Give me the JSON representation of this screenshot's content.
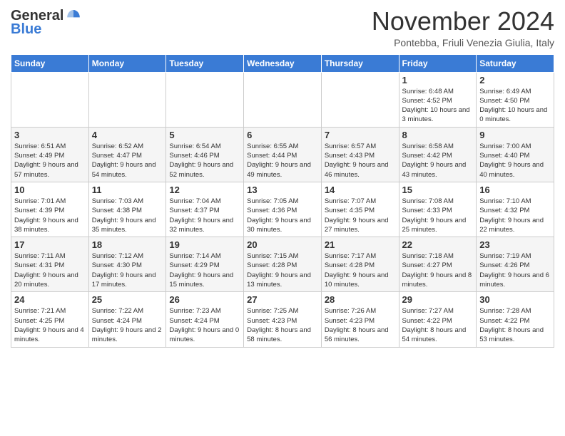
{
  "logo": {
    "general": "General",
    "blue": "Blue"
  },
  "title": "November 2024",
  "location": "Pontebba, Friuli Venezia Giulia, Italy",
  "days_of_week": [
    "Sunday",
    "Monday",
    "Tuesday",
    "Wednesday",
    "Thursday",
    "Friday",
    "Saturday"
  ],
  "weeks": [
    [
      {
        "day": "",
        "content": ""
      },
      {
        "day": "",
        "content": ""
      },
      {
        "day": "",
        "content": ""
      },
      {
        "day": "",
        "content": ""
      },
      {
        "day": "",
        "content": ""
      },
      {
        "day": "1",
        "content": "Sunrise: 6:48 AM\nSunset: 4:52 PM\nDaylight: 10 hours and 3 minutes."
      },
      {
        "day": "2",
        "content": "Sunrise: 6:49 AM\nSunset: 4:50 PM\nDaylight: 10 hours and 0 minutes."
      }
    ],
    [
      {
        "day": "3",
        "content": "Sunrise: 6:51 AM\nSunset: 4:49 PM\nDaylight: 9 hours and 57 minutes."
      },
      {
        "day": "4",
        "content": "Sunrise: 6:52 AM\nSunset: 4:47 PM\nDaylight: 9 hours and 54 minutes."
      },
      {
        "day": "5",
        "content": "Sunrise: 6:54 AM\nSunset: 4:46 PM\nDaylight: 9 hours and 52 minutes."
      },
      {
        "day": "6",
        "content": "Sunrise: 6:55 AM\nSunset: 4:44 PM\nDaylight: 9 hours and 49 minutes."
      },
      {
        "day": "7",
        "content": "Sunrise: 6:57 AM\nSunset: 4:43 PM\nDaylight: 9 hours and 46 minutes."
      },
      {
        "day": "8",
        "content": "Sunrise: 6:58 AM\nSunset: 4:42 PM\nDaylight: 9 hours and 43 minutes."
      },
      {
        "day": "9",
        "content": "Sunrise: 7:00 AM\nSunset: 4:40 PM\nDaylight: 9 hours and 40 minutes."
      }
    ],
    [
      {
        "day": "10",
        "content": "Sunrise: 7:01 AM\nSunset: 4:39 PM\nDaylight: 9 hours and 38 minutes."
      },
      {
        "day": "11",
        "content": "Sunrise: 7:03 AM\nSunset: 4:38 PM\nDaylight: 9 hours and 35 minutes."
      },
      {
        "day": "12",
        "content": "Sunrise: 7:04 AM\nSunset: 4:37 PM\nDaylight: 9 hours and 32 minutes."
      },
      {
        "day": "13",
        "content": "Sunrise: 7:05 AM\nSunset: 4:36 PM\nDaylight: 9 hours and 30 minutes."
      },
      {
        "day": "14",
        "content": "Sunrise: 7:07 AM\nSunset: 4:35 PM\nDaylight: 9 hours and 27 minutes."
      },
      {
        "day": "15",
        "content": "Sunrise: 7:08 AM\nSunset: 4:33 PM\nDaylight: 9 hours and 25 minutes."
      },
      {
        "day": "16",
        "content": "Sunrise: 7:10 AM\nSunset: 4:32 PM\nDaylight: 9 hours and 22 minutes."
      }
    ],
    [
      {
        "day": "17",
        "content": "Sunrise: 7:11 AM\nSunset: 4:31 PM\nDaylight: 9 hours and 20 minutes."
      },
      {
        "day": "18",
        "content": "Sunrise: 7:12 AM\nSunset: 4:30 PM\nDaylight: 9 hours and 17 minutes."
      },
      {
        "day": "19",
        "content": "Sunrise: 7:14 AM\nSunset: 4:29 PM\nDaylight: 9 hours and 15 minutes."
      },
      {
        "day": "20",
        "content": "Sunrise: 7:15 AM\nSunset: 4:28 PM\nDaylight: 9 hours and 13 minutes."
      },
      {
        "day": "21",
        "content": "Sunrise: 7:17 AM\nSunset: 4:28 PM\nDaylight: 9 hours and 10 minutes."
      },
      {
        "day": "22",
        "content": "Sunrise: 7:18 AM\nSunset: 4:27 PM\nDaylight: 9 hours and 8 minutes."
      },
      {
        "day": "23",
        "content": "Sunrise: 7:19 AM\nSunset: 4:26 PM\nDaylight: 9 hours and 6 minutes."
      }
    ],
    [
      {
        "day": "24",
        "content": "Sunrise: 7:21 AM\nSunset: 4:25 PM\nDaylight: 9 hours and 4 minutes."
      },
      {
        "day": "25",
        "content": "Sunrise: 7:22 AM\nSunset: 4:24 PM\nDaylight: 9 hours and 2 minutes."
      },
      {
        "day": "26",
        "content": "Sunrise: 7:23 AM\nSunset: 4:24 PM\nDaylight: 9 hours and 0 minutes."
      },
      {
        "day": "27",
        "content": "Sunrise: 7:25 AM\nSunset: 4:23 PM\nDaylight: 8 hours and 58 minutes."
      },
      {
        "day": "28",
        "content": "Sunrise: 7:26 AM\nSunset: 4:23 PM\nDaylight: 8 hours and 56 minutes."
      },
      {
        "day": "29",
        "content": "Sunrise: 7:27 AM\nSunset: 4:22 PM\nDaylight: 8 hours and 54 minutes."
      },
      {
        "day": "30",
        "content": "Sunrise: 7:28 AM\nSunset: 4:22 PM\nDaylight: 8 hours and 53 minutes."
      }
    ]
  ]
}
